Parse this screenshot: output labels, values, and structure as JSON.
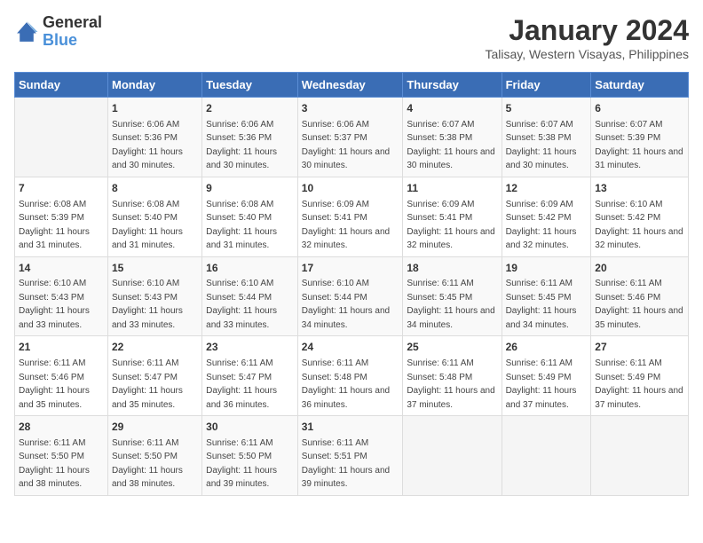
{
  "logo": {
    "text_general": "General",
    "text_blue": "Blue"
  },
  "title": "January 2024",
  "subtitle": "Talisay, Western Visayas, Philippines",
  "header_days": [
    "Sunday",
    "Monday",
    "Tuesday",
    "Wednesday",
    "Thursday",
    "Friday",
    "Saturday"
  ],
  "weeks": [
    [
      {
        "day": "",
        "sunrise": "",
        "sunset": "",
        "daylight": ""
      },
      {
        "day": "1",
        "sunrise": "Sunrise: 6:06 AM",
        "sunset": "Sunset: 5:36 PM",
        "daylight": "Daylight: 11 hours and 30 minutes."
      },
      {
        "day": "2",
        "sunrise": "Sunrise: 6:06 AM",
        "sunset": "Sunset: 5:36 PM",
        "daylight": "Daylight: 11 hours and 30 minutes."
      },
      {
        "day": "3",
        "sunrise": "Sunrise: 6:06 AM",
        "sunset": "Sunset: 5:37 PM",
        "daylight": "Daylight: 11 hours and 30 minutes."
      },
      {
        "day": "4",
        "sunrise": "Sunrise: 6:07 AM",
        "sunset": "Sunset: 5:38 PM",
        "daylight": "Daylight: 11 hours and 30 minutes."
      },
      {
        "day": "5",
        "sunrise": "Sunrise: 6:07 AM",
        "sunset": "Sunset: 5:38 PM",
        "daylight": "Daylight: 11 hours and 30 minutes."
      },
      {
        "day": "6",
        "sunrise": "Sunrise: 6:07 AM",
        "sunset": "Sunset: 5:39 PM",
        "daylight": "Daylight: 11 hours and 31 minutes."
      }
    ],
    [
      {
        "day": "7",
        "sunrise": "Sunrise: 6:08 AM",
        "sunset": "Sunset: 5:39 PM",
        "daylight": "Daylight: 11 hours and 31 minutes."
      },
      {
        "day": "8",
        "sunrise": "Sunrise: 6:08 AM",
        "sunset": "Sunset: 5:40 PM",
        "daylight": "Daylight: 11 hours and 31 minutes."
      },
      {
        "day": "9",
        "sunrise": "Sunrise: 6:08 AM",
        "sunset": "Sunset: 5:40 PM",
        "daylight": "Daylight: 11 hours and 31 minutes."
      },
      {
        "day": "10",
        "sunrise": "Sunrise: 6:09 AM",
        "sunset": "Sunset: 5:41 PM",
        "daylight": "Daylight: 11 hours and 32 minutes."
      },
      {
        "day": "11",
        "sunrise": "Sunrise: 6:09 AM",
        "sunset": "Sunset: 5:41 PM",
        "daylight": "Daylight: 11 hours and 32 minutes."
      },
      {
        "day": "12",
        "sunrise": "Sunrise: 6:09 AM",
        "sunset": "Sunset: 5:42 PM",
        "daylight": "Daylight: 11 hours and 32 minutes."
      },
      {
        "day": "13",
        "sunrise": "Sunrise: 6:10 AM",
        "sunset": "Sunset: 5:42 PM",
        "daylight": "Daylight: 11 hours and 32 minutes."
      }
    ],
    [
      {
        "day": "14",
        "sunrise": "Sunrise: 6:10 AM",
        "sunset": "Sunset: 5:43 PM",
        "daylight": "Daylight: 11 hours and 33 minutes."
      },
      {
        "day": "15",
        "sunrise": "Sunrise: 6:10 AM",
        "sunset": "Sunset: 5:43 PM",
        "daylight": "Daylight: 11 hours and 33 minutes."
      },
      {
        "day": "16",
        "sunrise": "Sunrise: 6:10 AM",
        "sunset": "Sunset: 5:44 PM",
        "daylight": "Daylight: 11 hours and 33 minutes."
      },
      {
        "day": "17",
        "sunrise": "Sunrise: 6:10 AM",
        "sunset": "Sunset: 5:44 PM",
        "daylight": "Daylight: 11 hours and 34 minutes."
      },
      {
        "day": "18",
        "sunrise": "Sunrise: 6:11 AM",
        "sunset": "Sunset: 5:45 PM",
        "daylight": "Daylight: 11 hours and 34 minutes."
      },
      {
        "day": "19",
        "sunrise": "Sunrise: 6:11 AM",
        "sunset": "Sunset: 5:45 PM",
        "daylight": "Daylight: 11 hours and 34 minutes."
      },
      {
        "day": "20",
        "sunrise": "Sunrise: 6:11 AM",
        "sunset": "Sunset: 5:46 PM",
        "daylight": "Daylight: 11 hours and 35 minutes."
      }
    ],
    [
      {
        "day": "21",
        "sunrise": "Sunrise: 6:11 AM",
        "sunset": "Sunset: 5:46 PM",
        "daylight": "Daylight: 11 hours and 35 minutes."
      },
      {
        "day": "22",
        "sunrise": "Sunrise: 6:11 AM",
        "sunset": "Sunset: 5:47 PM",
        "daylight": "Daylight: 11 hours and 35 minutes."
      },
      {
        "day": "23",
        "sunrise": "Sunrise: 6:11 AM",
        "sunset": "Sunset: 5:47 PM",
        "daylight": "Daylight: 11 hours and 36 minutes."
      },
      {
        "day": "24",
        "sunrise": "Sunrise: 6:11 AM",
        "sunset": "Sunset: 5:48 PM",
        "daylight": "Daylight: 11 hours and 36 minutes."
      },
      {
        "day": "25",
        "sunrise": "Sunrise: 6:11 AM",
        "sunset": "Sunset: 5:48 PM",
        "daylight": "Daylight: 11 hours and 37 minutes."
      },
      {
        "day": "26",
        "sunrise": "Sunrise: 6:11 AM",
        "sunset": "Sunset: 5:49 PM",
        "daylight": "Daylight: 11 hours and 37 minutes."
      },
      {
        "day": "27",
        "sunrise": "Sunrise: 6:11 AM",
        "sunset": "Sunset: 5:49 PM",
        "daylight": "Daylight: 11 hours and 37 minutes."
      }
    ],
    [
      {
        "day": "28",
        "sunrise": "Sunrise: 6:11 AM",
        "sunset": "Sunset: 5:50 PM",
        "daylight": "Daylight: 11 hours and 38 minutes."
      },
      {
        "day": "29",
        "sunrise": "Sunrise: 6:11 AM",
        "sunset": "Sunset: 5:50 PM",
        "daylight": "Daylight: 11 hours and 38 minutes."
      },
      {
        "day": "30",
        "sunrise": "Sunrise: 6:11 AM",
        "sunset": "Sunset: 5:50 PM",
        "daylight": "Daylight: 11 hours and 39 minutes."
      },
      {
        "day": "31",
        "sunrise": "Sunrise: 6:11 AM",
        "sunset": "Sunset: 5:51 PM",
        "daylight": "Daylight: 11 hours and 39 minutes."
      },
      {
        "day": "",
        "sunrise": "",
        "sunset": "",
        "daylight": ""
      },
      {
        "day": "",
        "sunrise": "",
        "sunset": "",
        "daylight": ""
      },
      {
        "day": "",
        "sunrise": "",
        "sunset": "",
        "daylight": ""
      }
    ]
  ]
}
